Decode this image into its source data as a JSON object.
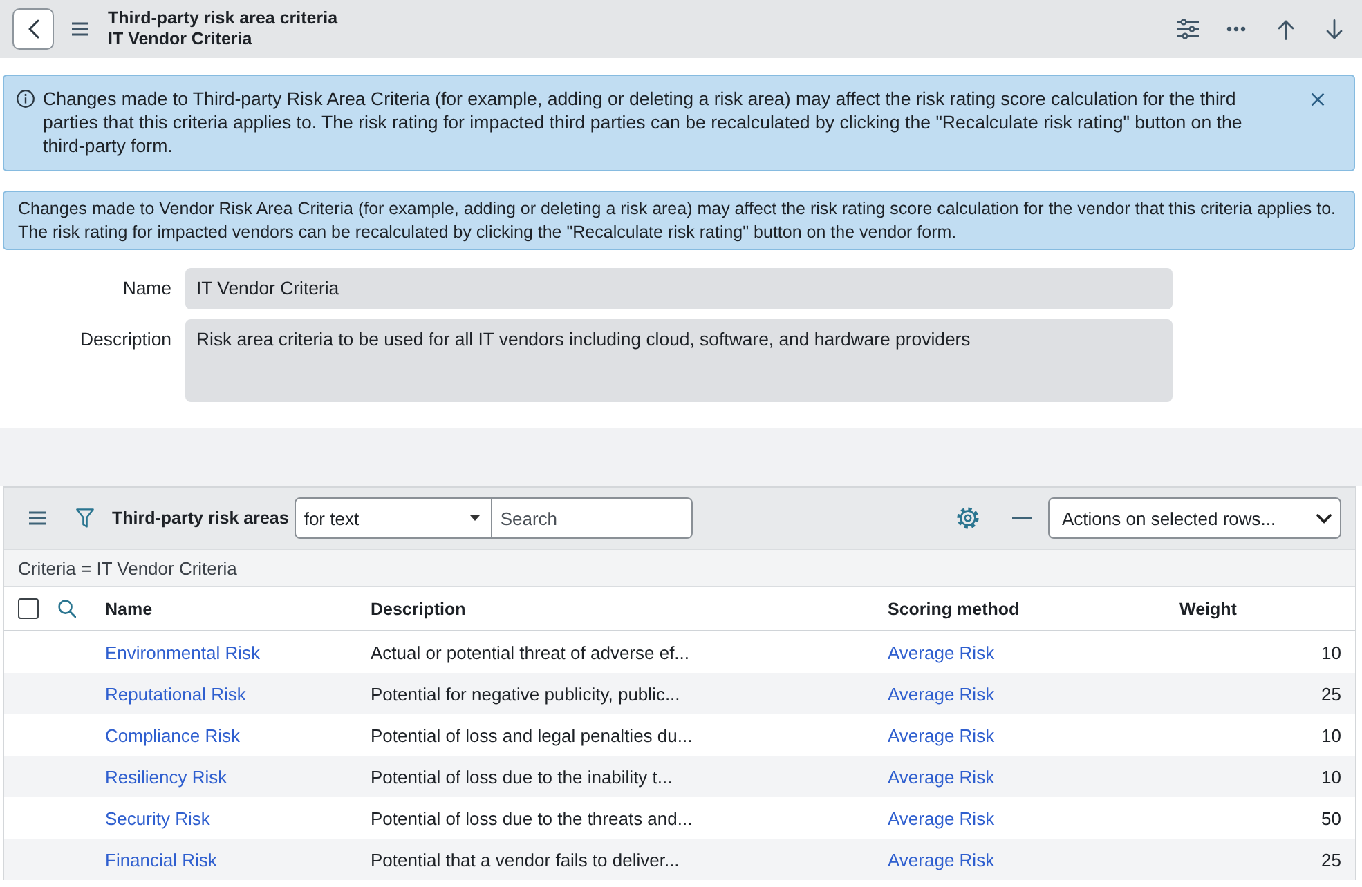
{
  "header": {
    "title": "Third-party risk area criteria",
    "subtitle": "IT Vendor Criteria"
  },
  "info_messages": [
    {
      "kind": "info",
      "dismissible": true,
      "text": "Changes made to Third-party Risk Area Criteria (for example, adding or deleting a risk area) may affect the risk rating score calculation for the third parties that this criteria applies to. The risk rating for impacted third parties can be recalculated by clicking the \"Recalculate risk rating\" button on the third-party form."
    },
    {
      "kind": "plain",
      "dismissible": false,
      "text": "Changes made to Vendor Risk Area Criteria (for example, adding or deleting a risk area) may affect the risk rating score calculation for the vendor that this criteria applies to. The risk rating for impacted vendors can be recalculated by clicking the \"Recalculate risk rating\" button on the vendor form."
    }
  ],
  "form": {
    "fields": [
      {
        "label": "Name",
        "value": "IT Vendor Criteria",
        "kind": "text",
        "read_only": true
      },
      {
        "label": "Description",
        "value": "Risk area criteria to be used for all IT vendors including cloud, software, and hardware providers",
        "kind": "textarea",
        "read_only": true
      }
    ]
  },
  "related_list": {
    "title": "Third-party risk areas",
    "filter_select": {
      "value": "for text"
    },
    "search": {
      "placeholder": "Search"
    },
    "actions_select": {
      "value": "Actions on selected rows..."
    },
    "breadcrumb": "Criteria = IT Vendor Criteria",
    "select_all": {
      "checked": false
    },
    "columns": [
      {
        "label": "Name",
        "kind": "link"
      },
      {
        "label": "Description",
        "kind": "text"
      },
      {
        "label": "Scoring method",
        "kind": "link"
      },
      {
        "label": "Weight",
        "kind": "number"
      }
    ],
    "rows": [
      {
        "cells": [
          "Environmental Risk",
          "Actual or potential threat of adverse ef...",
          "Average Risk",
          "10"
        ]
      },
      {
        "cells": [
          "Reputational Risk",
          "Potential for negative publicity, public...",
          "Average Risk",
          "25"
        ]
      },
      {
        "cells": [
          "Compliance Risk",
          "Potential of loss and legal penalties du...",
          "Average Risk",
          "10"
        ]
      },
      {
        "cells": [
          "Resiliency Risk",
          "Potential of loss due to the inability t...",
          "Average Risk",
          "10"
        ]
      },
      {
        "cells": [
          "Security Risk",
          "Potential of loss due to the threats and...",
          "Average Risk",
          "50"
        ]
      },
      {
        "cells": [
          "Financial Risk",
          "Potential that a vendor fails to deliver...",
          "Average Risk",
          "25"
        ]
      }
    ]
  }
}
